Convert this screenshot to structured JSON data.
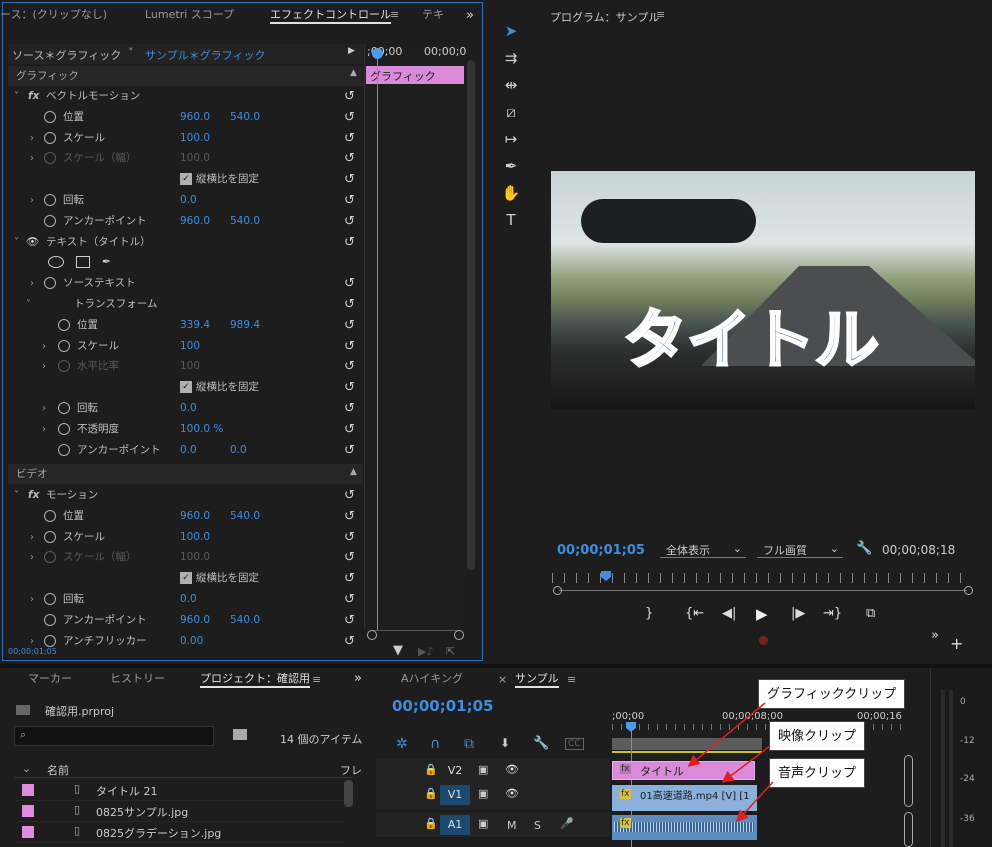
{
  "effect_panel": {
    "tabs": [
      "ース：(クリップなし)",
      "Lumetri スコープ",
      "エフェクトコントロール",
      "テキ"
    ],
    "source_label": "ソース＊グラフィック",
    "seq_label": "サンプル＊グラフィック",
    "mini_tl_start": ";00;00",
    "mini_tl_end": "00;00;0",
    "clip_label": "グラフィック",
    "timecode": "00;00;01;05",
    "sections": {
      "graphic": "グラフィック",
      "video": "ビデオ"
    },
    "rows": [
      {
        "caret": "˅",
        "fx": true,
        "lbl": "ベクトルモーション"
      },
      {
        "sw": true,
        "lbl": "位置",
        "v1": "960.0",
        "v2": "540.0"
      },
      {
        "caret": "›",
        "sw": true,
        "lbl": "スケール",
        "v1": "100.0"
      },
      {
        "caret": "›",
        "sw": true,
        "lbl": "スケール（幅）",
        "v1": "100.0",
        "dim": true
      },
      {
        "chk": "縦横比を固定"
      },
      {
        "caret": "›",
        "sw": true,
        "lbl": "回転",
        "v1": "0.0"
      },
      {
        "sw": true,
        "lbl": "アンカーポイント",
        "v1": "960.0",
        "v2": "540.0"
      },
      {
        "caret": "˅",
        "eye": true,
        "lbl": "テキスト（タイトル）"
      },
      {
        "shapes": true
      },
      {
        "caret": "›",
        "sw": true,
        "lbl": "ソーステキスト"
      },
      {
        "caret": "˅",
        "lbl": "トランスフォーム",
        "indent": true
      },
      {
        "sw": true,
        "lbl": "位置",
        "v1": "339.4",
        "v2": "989.4",
        "indent": true
      },
      {
        "caret": "›",
        "sw": true,
        "lbl": "スケール",
        "v1": "100",
        "indent": true
      },
      {
        "caret": "›",
        "sw": true,
        "lbl": "水平比率",
        "v1": "100",
        "dim": true,
        "indent": true
      },
      {
        "chk": "縦横比を固定"
      },
      {
        "caret": "›",
        "sw": true,
        "lbl": "回転",
        "v1": "0.0",
        "indent": true
      },
      {
        "caret": "›",
        "sw": true,
        "lbl": "不透明度",
        "v1": "100.0 %",
        "indent": true
      },
      {
        "sw": true,
        "lbl": "アンカーポイント",
        "v1": "0.0",
        "v2": "0.0",
        "indent": true
      }
    ],
    "video_rows": [
      {
        "caret": "˅",
        "fx": true,
        "lbl": "モーション"
      },
      {
        "sw": true,
        "lbl": "位置",
        "v1": "960.0",
        "v2": "540.0"
      },
      {
        "caret": "›",
        "sw": true,
        "lbl": "スケール",
        "v1": "100.0"
      },
      {
        "caret": "›",
        "sw": true,
        "lbl": "スケール（幅）",
        "v1": "100.0",
        "dim": true
      },
      {
        "chk": "縦横比を固定"
      },
      {
        "caret": "›",
        "sw": true,
        "lbl": "回転",
        "v1": "0.0"
      },
      {
        "sw": true,
        "lbl": "アンカーポイント",
        "v1": "960.0",
        "v2": "540.0"
      },
      {
        "caret": "›",
        "sw": true,
        "lbl": "アンチフリッカー",
        "v1": "0.00"
      }
    ]
  },
  "program": {
    "title": "プログラム：サンプル",
    "overlay_text": "タイトル",
    "timecode": "00;00;01;05",
    "zoom": "全体表示",
    "quality": "フル画質",
    "duration": "00;00;08;18"
  },
  "project": {
    "tabs": [
      "マーカー",
      "ヒストリー",
      "プロジェクト：確認用"
    ],
    "file": "確認用.prproj",
    "count": "14 個のアイテム",
    "col_name": "名前",
    "col_fr": "フレ",
    "items": [
      "タイトル 21",
      "0825サンプル.jpg",
      "0825グラデーション.jpg"
    ]
  },
  "timeline": {
    "tabs": [
      "Aハイキング",
      "サンプル"
    ],
    "timecode": "00;00;01;05",
    "ruler": [
      ";00;00",
      "00;00;08;00",
      "00;00;16"
    ],
    "tracks": [
      "V2",
      "V1",
      "A1"
    ],
    "title_clip": "タイトル",
    "video_clip": "01高速道路.mp4 [V] [1"
  },
  "callouts": {
    "graphic": "グラフィッククリップ",
    "video": "映像クリップ",
    "audio": "音声クリップ"
  },
  "meter": {
    "labels": [
      "0",
      "-12",
      "-24",
      "-36"
    ]
  }
}
